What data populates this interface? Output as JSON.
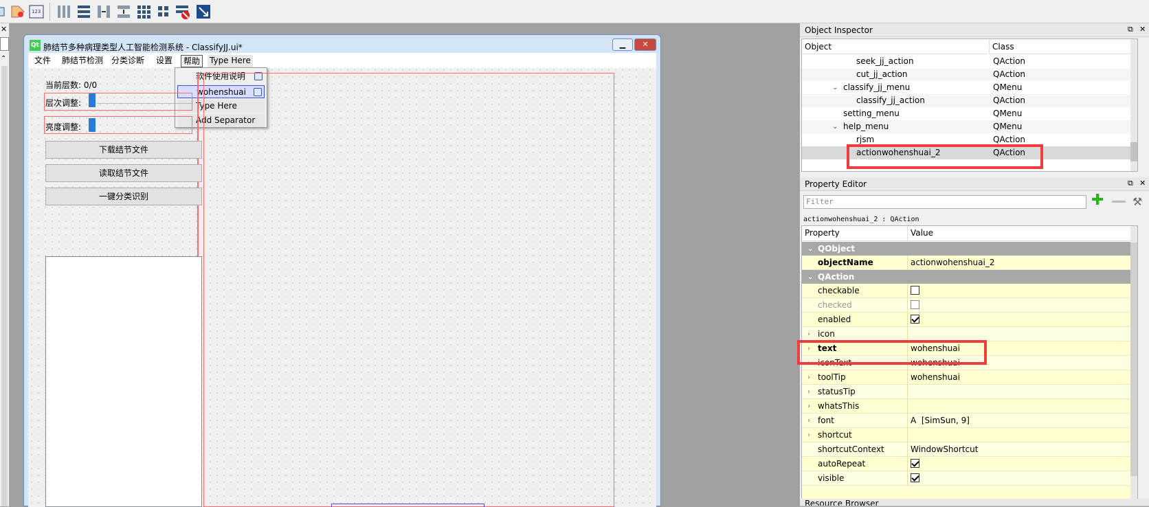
{
  "toolbar": {
    "icons": [
      "edit-widgets-icon",
      "edit-signals-icon",
      "edit-buddies-icon",
      "edit-tab-order-icon",
      "layout-horizontal-icon",
      "layout-vertical-icon",
      "layout-horizontal-splitter-icon",
      "layout-vertical-splitter-icon",
      "layout-grid-icon",
      "layout-form-icon",
      "break-layout-icon",
      "adjust-size-icon"
    ]
  },
  "window": {
    "title": "肺结节多种病理类型人工智能检测系统 - ClassifyJJ.ui*",
    "menu": [
      "文件",
      "肺结节检测",
      "分类诊断",
      "设置",
      "帮助",
      "Type Here"
    ],
    "popup": [
      "软件使用说明",
      "wohenshuai",
      "Type Here",
      "Add Separator"
    ],
    "layer_label": "当前层数: 0/0",
    "layer_adjust": "层次调整:",
    "brightness_adjust": "亮度调整:",
    "buttons": [
      "下载结节文件",
      "读取结节文件",
      "一键分类识别"
    ]
  },
  "object_inspector": {
    "title": "Object Inspector",
    "headers": [
      "Object",
      "Class"
    ],
    "rows": [
      {
        "object": "seek_jj_action",
        "class": "QAction"
      },
      {
        "object": "cut_jj_action",
        "class": "QAction"
      },
      {
        "object": "classify_jj_menu",
        "class": "QMenu"
      },
      {
        "object": "classify_jj_action",
        "class": "QAction"
      },
      {
        "object": "setting_menu",
        "class": "QMenu"
      },
      {
        "object": "help_menu",
        "class": "QMenu"
      },
      {
        "object": "rjsm",
        "class": "QAction"
      },
      {
        "object": "actionwohenshuai_2",
        "class": "QAction"
      }
    ]
  },
  "property_editor": {
    "title": "Property Editor",
    "filter_placeholder": "Filter",
    "subtitle": "actionwohenshuai_2 : QAction",
    "headers": [
      "Property",
      "Value"
    ],
    "rows": [
      {
        "name": "QObject",
        "value": ""
      },
      {
        "name": "objectName",
        "value": "actionwohenshuai_2"
      },
      {
        "name": "QAction",
        "value": ""
      },
      {
        "name": "checkable",
        "value": ""
      },
      {
        "name": "checked",
        "value": ""
      },
      {
        "name": "enabled",
        "value": ""
      },
      {
        "name": "icon",
        "value": ""
      },
      {
        "name": "text",
        "value": "wohenshuai"
      },
      {
        "name": "iconText",
        "value": "wohenshuai"
      },
      {
        "name": "toolTip",
        "value": "wohenshuai"
      },
      {
        "name": "statusTip",
        "value": ""
      },
      {
        "name": "whatsThis",
        "value": ""
      },
      {
        "name": "font",
        "value": "[SimSun, 9]"
      },
      {
        "name": "shortcut",
        "value": ""
      },
      {
        "name": "shortcutContext",
        "value": "WindowShortcut"
      },
      {
        "name": "autoRepeat",
        "value": ""
      },
      {
        "name": "visible",
        "value": ""
      }
    ],
    "checkbox_states": {
      "checkable": false,
      "checked": false,
      "enabled": true,
      "autoRepeat": true,
      "visible": true
    }
  },
  "resource_browser": {
    "title": "Resource Browser"
  },
  "colors": {
    "highlight": "#ef3c3c",
    "group_header": "#a8a8a8",
    "property_bg": "#ffffcf"
  }
}
